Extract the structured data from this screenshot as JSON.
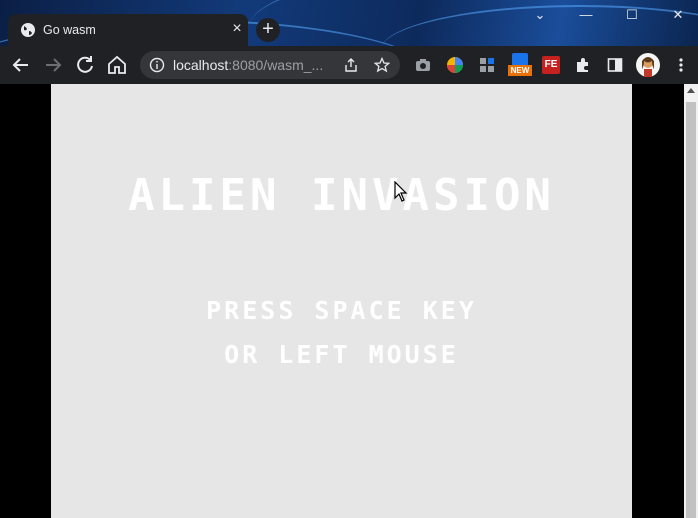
{
  "browser": {
    "tab_title": "Go wasm",
    "tab_close": "×",
    "new_tab": "+",
    "window_controls": {
      "minimize": "—",
      "maximize": "☐",
      "close": "✕",
      "dropdown": "⌄"
    },
    "url_host": "localhost",
    "url_rest": ":8080/wasm_...",
    "extension_badge": "NEW",
    "extension_fe_label": "FE"
  },
  "game": {
    "title": "ALIEN INVASION",
    "prompt_line1": "PRESS SPACE KEY",
    "prompt_line2": "OR LEFT MOUSE"
  },
  "colors": {
    "game_background": "#e6e6e6",
    "game_text": "#ffffff",
    "browser_dark": "#202124"
  }
}
